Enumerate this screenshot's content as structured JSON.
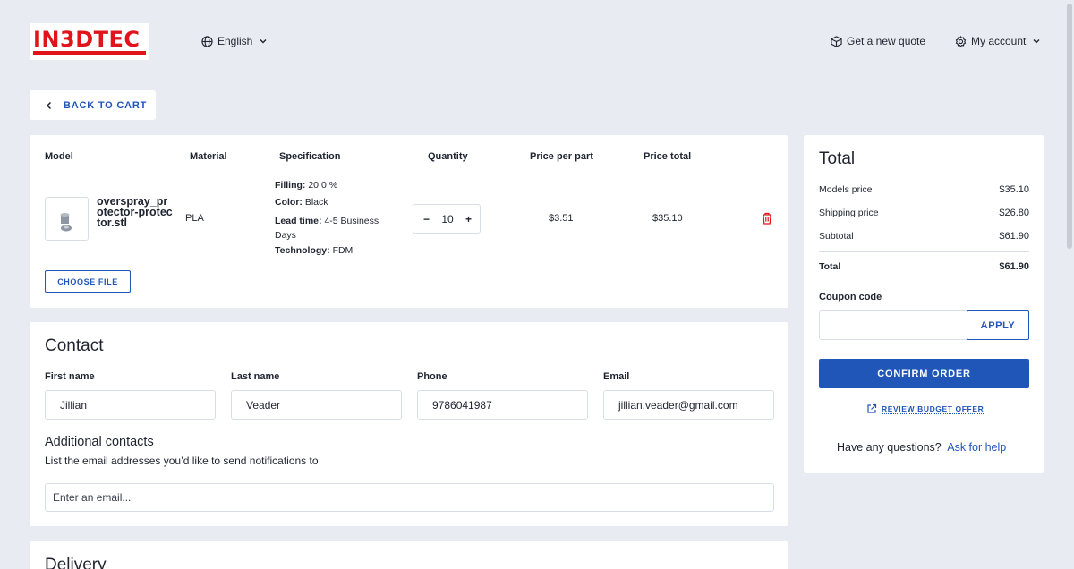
{
  "header": {
    "logo_text": "IN3DTEC",
    "language": "English",
    "new_quote": "Get a new quote",
    "account": "My account"
  },
  "back_to_cart": "BACK TO CART",
  "cart": {
    "columns": [
      "Model",
      "Material",
      "Specification",
      "Quantity",
      "Price per part",
      "Price total"
    ],
    "item": {
      "filename": "overspray_pr otector-protec tor.stl",
      "filename_lines": [
        "overspray_pr",
        "otector-protec",
        "tor.stl"
      ],
      "material": "PLA",
      "spec": {
        "filling_label": "Filling:",
        "filling": "20.0 %",
        "color_label": "Color:",
        "color": "Black",
        "lead_label": "Lead time:",
        "lead_time_1": "4-5 Business",
        "lead_time_2": "Days",
        "tech_label": "Technology:",
        "technology": "FDM"
      },
      "quantity": "10",
      "minus": "−",
      "plus": "+",
      "price_per_part": "$3.51",
      "price_total": "$35.10"
    },
    "choose_file": "CHOOSE FILE"
  },
  "contact": {
    "title": "Contact",
    "first_name_label": "First name",
    "first_name": "Jillian",
    "last_name_label": "Last name",
    "last_name": "Veader",
    "phone_label": "Phone",
    "phone": "9786041987",
    "email_label": "Email",
    "email": "jillian.veader@gmail.com",
    "additional_title": "Additional contacts",
    "additional_desc": "List the email addresses you’d like to send notifications to",
    "additional_placeholder": "Enter an email..."
  },
  "delivery": {
    "title": "Delivery"
  },
  "summary": {
    "title": "Total",
    "models_price_label": "Models price",
    "models_price": "$35.10",
    "shipping_label": "Shipping price",
    "shipping": "$26.80",
    "subtotal_label": "Subtotal",
    "subtotal": "$61.90",
    "total_label": "Total",
    "total": "$61.90",
    "coupon_label": "Coupon code",
    "coupon_value": "",
    "apply": "APPLY",
    "confirm": "CONFIRM ORDER",
    "review": "REVIEW BUDGET OFFER",
    "questions": "Have any questions?",
    "ask_help": "Ask for help"
  },
  "colors": {
    "accent": "#1f56b8",
    "brand_red": "#e0141b",
    "background": "#e8ecf2"
  }
}
